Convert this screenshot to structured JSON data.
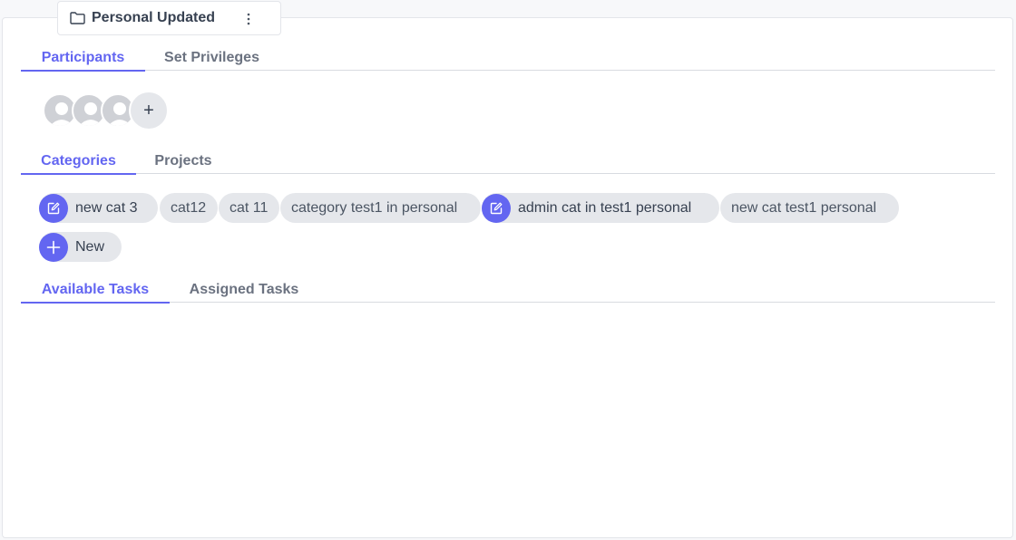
{
  "folder": {
    "title": "Personal Updated",
    "icon": "folder-icon",
    "menu_icon": "kebab-menu-icon"
  },
  "participants_tabs": [
    "Participants",
    "Set Privileges"
  ],
  "participants": {
    "avatar_count": 3,
    "add_label": "+"
  },
  "category_tabs": [
    "Categories",
    "Projects"
  ],
  "categories": [
    {
      "label": "new cat 3",
      "editable": true
    },
    {
      "label": "cat12",
      "editable": false
    },
    {
      "label": "cat 11",
      "editable": false
    },
    {
      "label": "category test1 in personal",
      "editable": false
    },
    {
      "label": "admin cat in test1 personal",
      "editable": true
    },
    {
      "label": "new cat test1 personal",
      "editable": false
    }
  ],
  "new_button": {
    "label": "New"
  },
  "task_tabs": [
    "Available Tasks",
    "Assigned Tasks"
  ],
  "colors": {
    "accent": "#6366f1",
    "chip_bg": "#e5e7eb",
    "border": "#e3e5ea"
  }
}
